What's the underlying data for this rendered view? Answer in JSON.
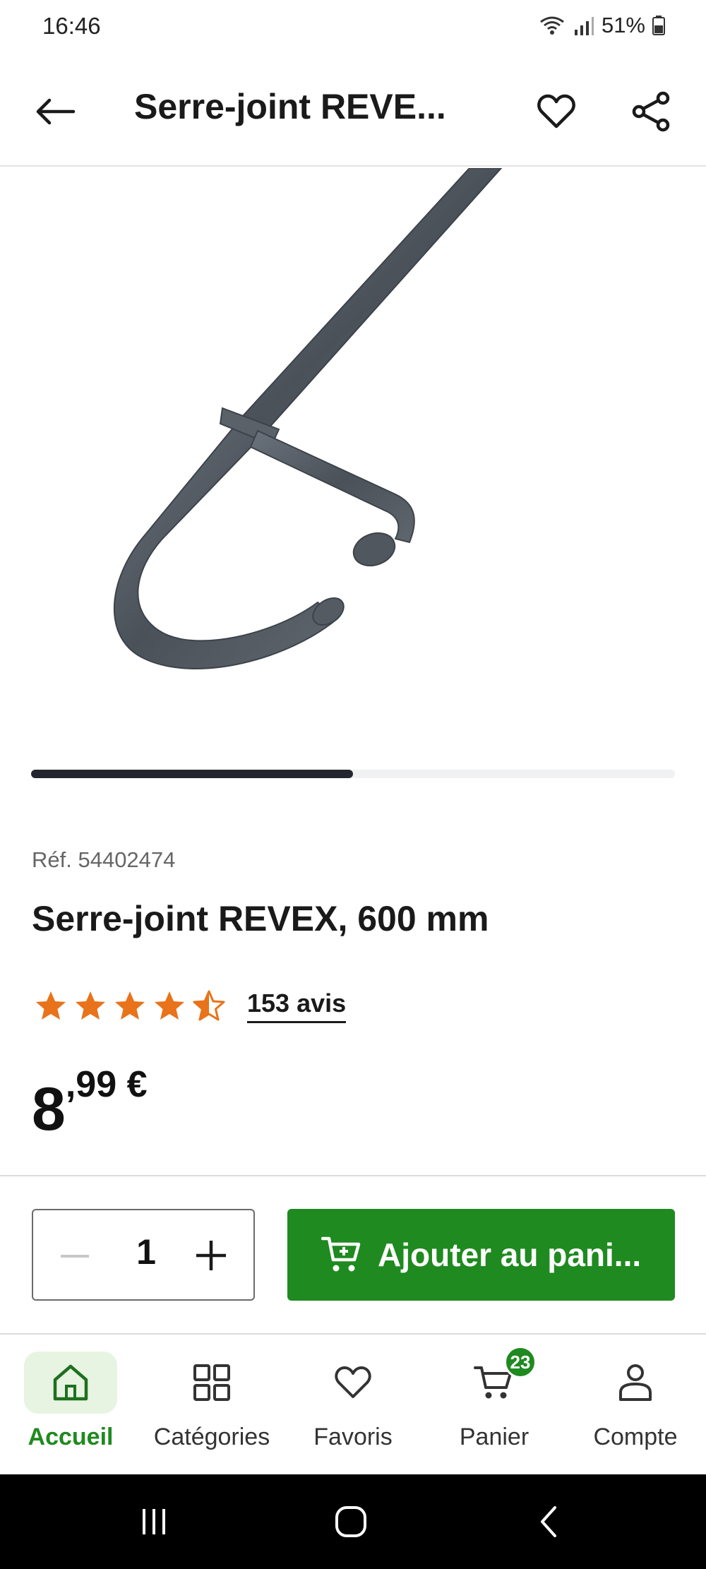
{
  "status_bar": {
    "time": "16:46",
    "battery": "51%"
  },
  "header": {
    "title": "Serre-joint REVE..."
  },
  "gallery": {
    "progress": 0.5
  },
  "product": {
    "reference": "Réf. 54402474",
    "title": "Serre-joint REVEX, 600 mm",
    "rating": 4.5,
    "reviews_label": "153 avis",
    "price_integer": "8",
    "price_decimal": ",99 €"
  },
  "purchase": {
    "quantity": "1",
    "add_to_cart_label": "Ajouter au pani..."
  },
  "bottom_nav": {
    "items": [
      {
        "label": "Accueil",
        "icon": "home-icon",
        "active": true
      },
      {
        "label": "Catégories",
        "icon": "grid-icon",
        "active": false
      },
      {
        "label": "Favoris",
        "icon": "heart-icon",
        "active": false
      },
      {
        "label": "Panier",
        "icon": "cart-icon",
        "active": false,
        "badge": "23"
      },
      {
        "label": "Compte",
        "icon": "user-icon",
        "active": false
      }
    ]
  },
  "colors": {
    "brand_green": "#1f8a1f",
    "star_orange": "#e8731a",
    "progress_dark": "#23262e"
  }
}
